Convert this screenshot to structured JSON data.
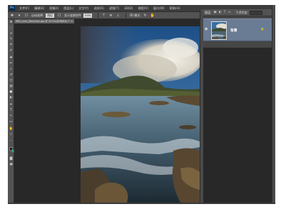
{
  "app": {
    "logo": "Ps",
    "menu": [
      "文件(F)",
      "编辑(E)",
      "图像(I)",
      "图层(L)",
      "文字(Y)",
      "选择(S)",
      "滤镜(T)",
      "3D(D)",
      "视图(V)",
      "窗口(W)",
      "帮助(H)"
    ]
  },
  "options": {
    "tool_icon": "move-icon",
    "auto_select_label": "自动选择:",
    "auto_select_value": "图层",
    "show_transform_label": "显示变换控件",
    "mode_3d_label": "3D 模式:",
    "zoom_value": "33%"
  },
  "document": {
    "tab_title": "IMG_Lone_Mountain.jpg @ 33.3%(RGB/8#) *",
    "tab_close": "×"
  },
  "layers_panel": {
    "title": "图层",
    "kind_label": "类型",
    "opacity_label": "不透明度:",
    "layer": {
      "name": "背景",
      "eye_icon": "eye-icon",
      "lock_icon": "lock-icon"
    }
  },
  "colors": {
    "foreground": "#000000",
    "background": "#28a86c",
    "selected_layer": "#6a7b94",
    "workspace": "#282828"
  }
}
